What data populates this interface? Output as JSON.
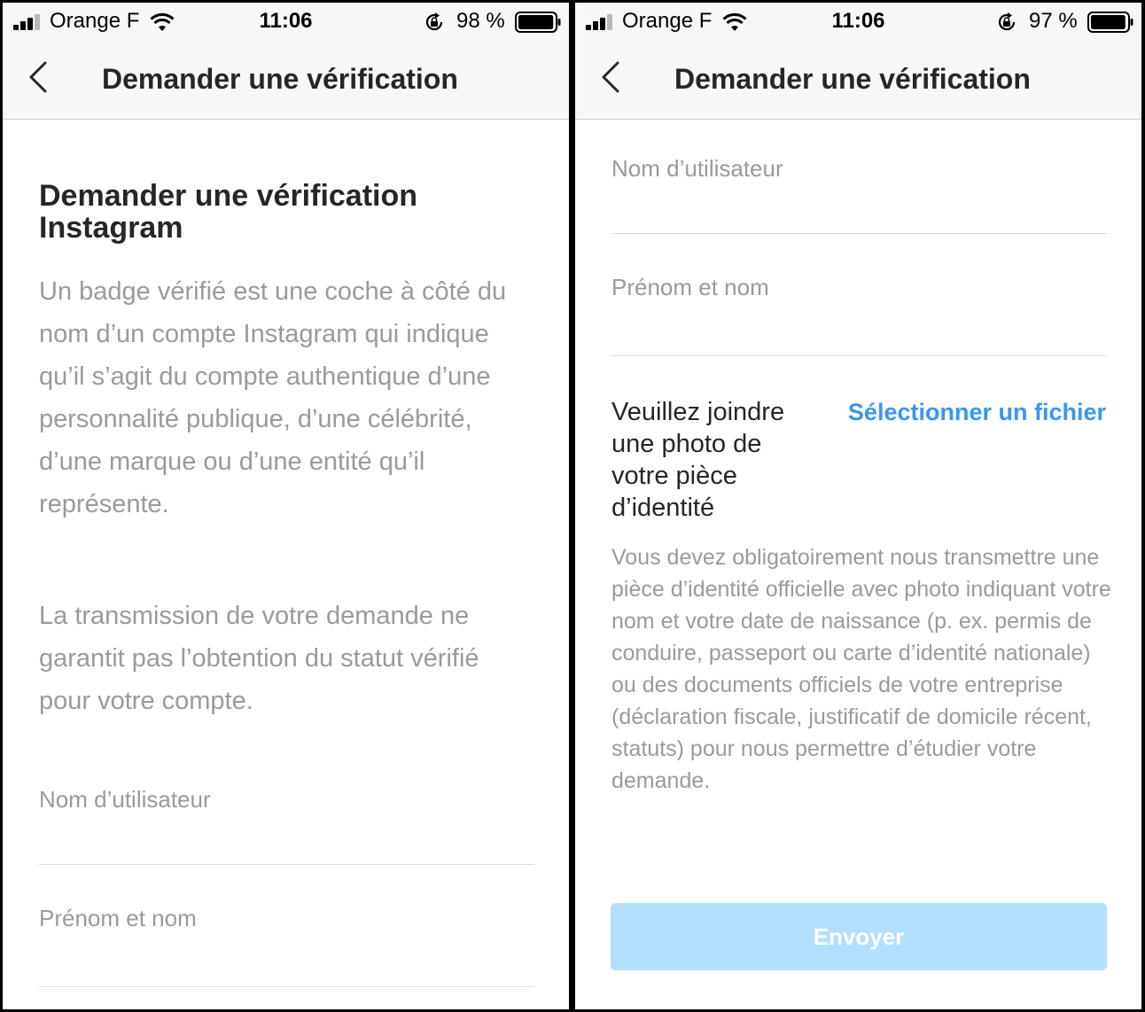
{
  "left": {
    "status": {
      "carrier": "Orange F",
      "time": "11:06",
      "battery": "98 %",
      "battery_level": 0.98
    },
    "nav": {
      "title": "Demander une vérification"
    },
    "heading": "Demander une vérification Instagram",
    "intro": "Un badge vérifié est une coche à côté du nom d’un compte Instagram qui indique qu’il s’agit du compte authentique d’une personnalité publique, d’une célébrité, d’une marque ou d’une entité qu’il représente.",
    "disclaimer": "La transmission de votre demande ne garantit pas l’obtention du statut vérifié pour votre compte.",
    "fields": {
      "username": "Nom d’utilisateur",
      "fullname": "Prénom et nom"
    }
  },
  "right": {
    "status": {
      "carrier": "Orange F",
      "time": "11:06",
      "battery": "97 %",
      "battery_level": 0.97
    },
    "nav": {
      "title": "Demander une vérification"
    },
    "fields": {
      "username": "Nom d’utilisateur",
      "fullname": "Prénom et nom"
    },
    "attach": {
      "label": "Veuillez joindre une photo de votre pièce d’identité",
      "link": "Sélectionner un fichier",
      "description": "Vous devez obligatoirement nous transmettre une pièce d’identité officielle avec photo indiquant votre nom et votre date de naissance (p. ex. permis de conduire, passeport ou carte d’identité nationale) ou des documents officiels de votre entreprise (déclaration fiscale, justificatif de domicile récent, statuts) pour nous permettre d’étudier votre demande."
    },
    "submit": "Envoyer"
  },
  "colors": {
    "link": "#3897f0",
    "button_disabled": "#b2dffc",
    "muted_text": "#9a9a9a",
    "primary_text": "#262626"
  }
}
